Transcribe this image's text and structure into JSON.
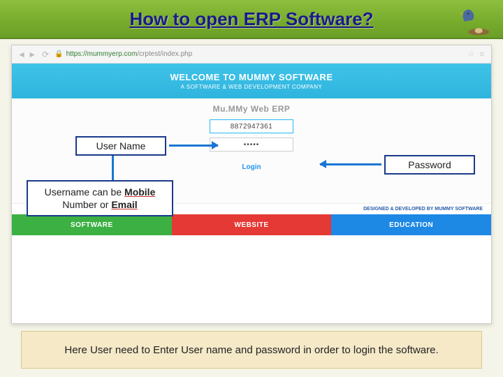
{
  "slide": {
    "title": "How to open ERP Software?"
  },
  "browser": {
    "url_prefix": "https://",
    "url_host": "mummyerp.com",
    "url_path": "/crptest/index.php"
  },
  "hero": {
    "title": "WELCOME TO MUMMY SOFTWARE",
    "subtitle": "A SOFTWARE & WEB DEVELOPMENT COMPANY"
  },
  "login": {
    "app_name": "Mu.MMy Web ERP",
    "username_value": "8872947361",
    "password_value": "•••••",
    "login_label": "Login"
  },
  "callouts": {
    "username": "User Name",
    "password": "Password",
    "note_prefix": "Username can be ",
    "note_mobile": "Mobile",
    "note_mid": " Number or ",
    "note_email": "Email"
  },
  "credit": "DESIGNED & DEVELOPED BY MUMMY SOFTWARE",
  "tabs": {
    "software": "SOFTWARE",
    "website": "WEBSITE",
    "education": "EDUCATION"
  },
  "caption": "Here User need to Enter User name and password in order to login the software."
}
